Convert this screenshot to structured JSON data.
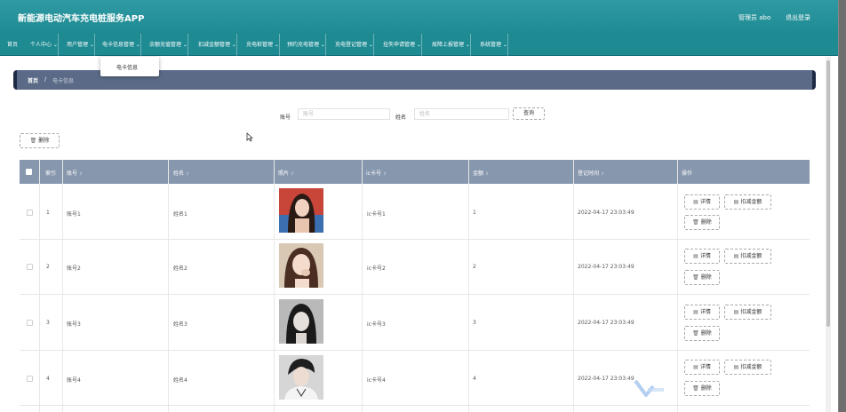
{
  "header": {
    "app_title": "新能源电动汽车充电桩服务APP",
    "admin_label": "管理员 abo",
    "logout_label": "退出登录"
  },
  "nav": [
    {
      "label": "首页"
    },
    {
      "label": "个人中心 ⌄"
    },
    {
      "label": "用户管理 ⌄"
    },
    {
      "label": "电卡信息管理 ⌄"
    },
    {
      "label": "余额充值管理 ⌄"
    },
    {
      "label": "扣减金额管理 ⌄"
    },
    {
      "label": "充电桩管理 ⌄"
    },
    {
      "label": "预约充电管理 ⌄"
    },
    {
      "label": "充电登记管理 ⌄"
    },
    {
      "label": "挂失申请管理 ⌄"
    },
    {
      "label": "故障上报管理 ⌄"
    },
    {
      "label": "系统管理 ⌄"
    }
  ],
  "dropdown": {
    "item": "电卡信息"
  },
  "breadcrumb": {
    "home": "首页",
    "separator": "/",
    "current": "电卡信息"
  },
  "search": {
    "account_label": "账号",
    "account_placeholder": "账号",
    "name_label": "姓名",
    "name_placeholder": "姓名",
    "query_button": "查询"
  },
  "toolbar": {
    "delete_label": "删除"
  },
  "table": {
    "columns": [
      "索引",
      "账号",
      "姓名",
      "照片",
      "ic卡号",
      "金额",
      "登记时间",
      "操作"
    ],
    "rows": [
      {
        "index": "1",
        "account": "账号1",
        "name": "姓名1",
        "ic": "ic卡号1",
        "amount": "1",
        "time": "2022-04-17 23:03:49"
      },
      {
        "index": "2",
        "account": "账号2",
        "name": "姓名2",
        "ic": "ic卡号2",
        "amount": "2",
        "time": "2022-04-17 23:03:49"
      },
      {
        "index": "3",
        "account": "账号3",
        "name": "姓名3",
        "ic": "ic卡号3",
        "amount": "3",
        "time": "2022-04-17 23:03:49"
      },
      {
        "index": "4",
        "account": "账号4",
        "name": "姓名4",
        "ic": "ic卡号4",
        "amount": "4",
        "time": "2022-04-17 23:03:49"
      }
    ],
    "actions": {
      "detail": "详情",
      "deduct": "扣减金额",
      "delete": "删除"
    }
  },
  "icons": {
    "trash": "trash-icon",
    "detail": "document-icon",
    "cursor": "mouse-cursor-icon",
    "watermark": "logo-watermark-icon"
  },
  "colors": {
    "header": "#1e8a92",
    "breadcrumb": "#5b6b87",
    "table_header": "#8797ad"
  }
}
